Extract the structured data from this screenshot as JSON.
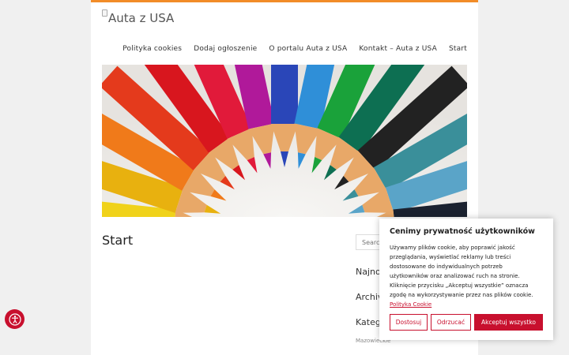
{
  "site": {
    "logo_alt": "Auta z USA"
  },
  "nav": {
    "items": [
      "Polityka cookies",
      "Dodaj ogłoszenie",
      "O portalu Auta z USA",
      "Kontakt – Auta z USA",
      "Start"
    ]
  },
  "main": {
    "title": "Start"
  },
  "sidebar": {
    "search_placeholder": "Search",
    "widget_1": "Najno",
    "widget_2": "Archiv",
    "widget_3": "Kateg",
    "category_item": "Mazowieckie"
  },
  "cookie": {
    "title": "Cenimy prywatność użytkowników",
    "text": "Używamy plików cookie, aby poprawić jakość przeglądania, wyświetlać reklamy lub treści dostosowane do indywidualnych potrzeb użytkowników oraz analizować ruch na stronie. Kliknięcie przycisku „Akceptuj wszystkie” oznacza zgodę na wykorzystywanie przez nas plików cookie.",
    "policy_link": "Polityka Cookie",
    "customize": "Dostosuj",
    "reject": "Odrzucać",
    "accept": "Akceptuj wszystko"
  },
  "accessibility": {
    "icon": "accessibility-icon"
  },
  "colors": {
    "accent": "#c8102e",
    "top_border": "#f28c28"
  }
}
